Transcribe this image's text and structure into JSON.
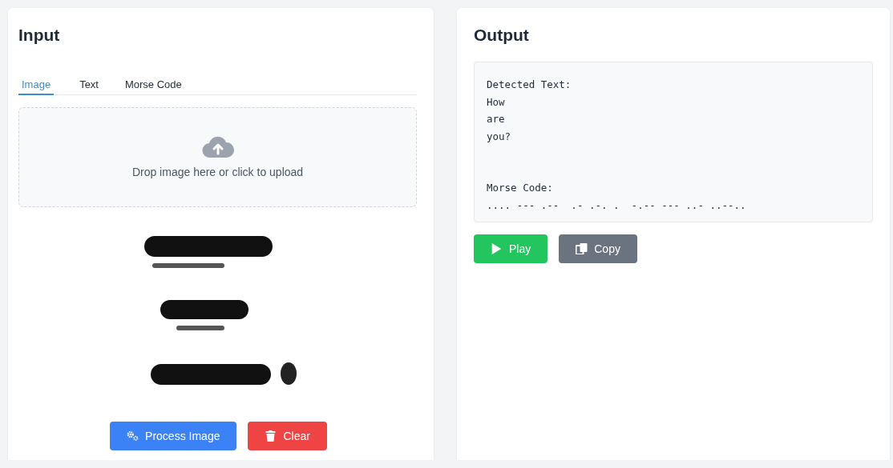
{
  "input": {
    "title": "Input",
    "tabs": [
      {
        "label": "Image",
        "selected": true
      },
      {
        "label": "Text",
        "selected": false
      },
      {
        "label": "Morse Code",
        "selected": false
      }
    ],
    "dropzone": {
      "label": "Drop image here or click to upload"
    },
    "buttons": [
      {
        "label": "Process Image",
        "kind": "process"
      },
      {
        "label": "Clear",
        "kind": "clear"
      }
    ]
  },
  "output": {
    "title": "Output",
    "detected_label": "Detected Text:",
    "detected_lines": [
      "How",
      "are",
      "you?"
    ],
    "morse_label": "Morse Code:",
    "morse": ".... --- .--  .- .-. .  -.-- --- ..- ..--..",
    "buttons": [
      {
        "label": "Play",
        "kind": "play"
      },
      {
        "label": "Copy",
        "kind": "copy"
      }
    ]
  }
}
